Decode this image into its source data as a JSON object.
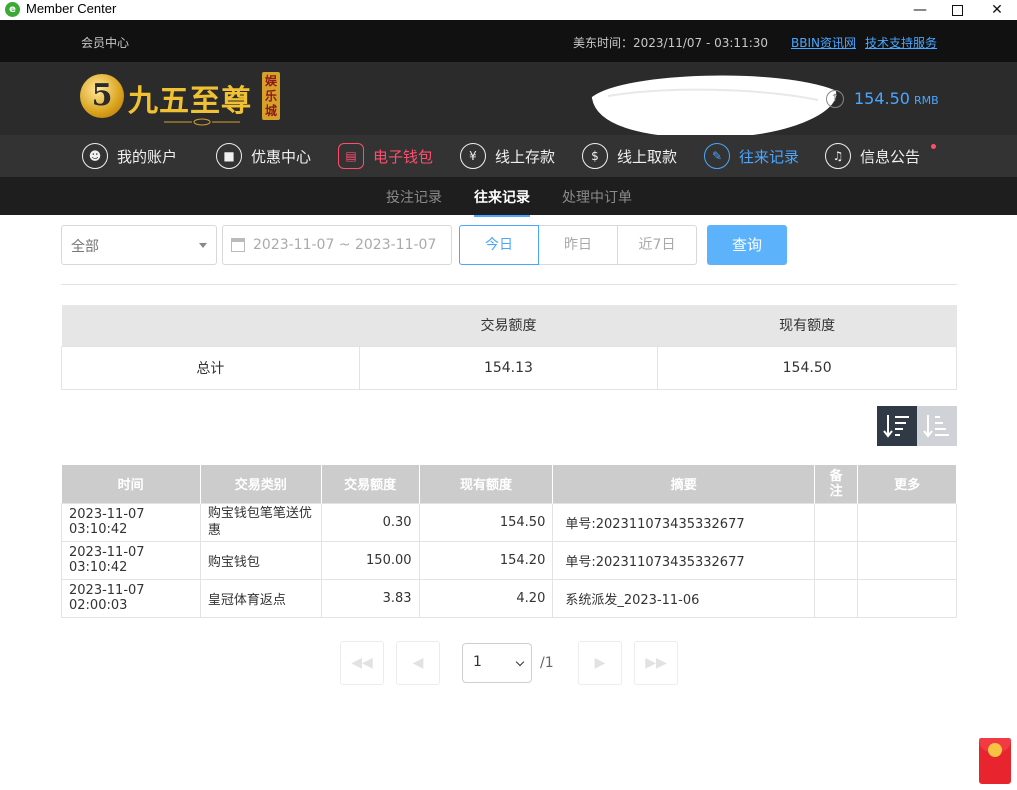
{
  "window": {
    "title": "Member Center",
    "app_icon_letter": "e"
  },
  "topbar": {
    "member_center": "会员中心",
    "time_text": "美东时间：2023/11/07 - 03:11:30",
    "link_news": "BBIN资讯网",
    "link_support": "技术支持服务"
  },
  "header": {
    "logo_numeral": "5",
    "logo_brand": "九五至尊",
    "logo_tag": "娱乐城",
    "balance_amount": "154.50",
    "balance_currency": "RMB"
  },
  "nav": {
    "items": [
      {
        "label": "我的账户",
        "icon": "user-icon"
      },
      {
        "label": "优惠中心",
        "icon": "gift-icon"
      },
      {
        "label": "电子钱包",
        "icon": "wallet-icon"
      },
      {
        "label": "线上存款",
        "icon": "deposit-icon"
      },
      {
        "label": "线上取款",
        "icon": "withdraw-icon"
      },
      {
        "label": "往来记录",
        "icon": "record-icon"
      },
      {
        "label": "信息公告",
        "icon": "bell-icon"
      }
    ],
    "active_index": 5,
    "wallet_color": "#ff4d6d",
    "active_color": "#4aa6ff"
  },
  "subnav": {
    "items": [
      "投注记录",
      "往来记录",
      "处理中订单"
    ],
    "active_index": 1
  },
  "filters": {
    "type_value": "全部",
    "date_range": "2023-11-07 ~ 2023-11-07",
    "today": "今日",
    "yesterday": "昨日",
    "last7": "近7日",
    "query": "查询"
  },
  "summary": {
    "headers": [
      "",
      "交易额度",
      "现有额度"
    ],
    "total_label": "总计",
    "trade_total": "154.13",
    "current_total": "154.50"
  },
  "records": {
    "headers": [
      "时间",
      "交易类别",
      "交易额度",
      "现有额度",
      "摘要",
      "备注",
      "更多"
    ],
    "rows": [
      {
        "time": "2023-11-07 03:10:42",
        "type": "购宝钱包笔笔送优惠",
        "amount": "0.30",
        "balance": "154.50",
        "summary": "单号:202311073435332677",
        "note": "",
        "more": ""
      },
      {
        "time": "2023-11-07 03:10:42",
        "type": "购宝钱包",
        "amount": "150.00",
        "balance": "154.20",
        "summary": "单号:202311073435332677",
        "note": "",
        "more": ""
      },
      {
        "time": "2023-11-07 02:00:03",
        "type": "皇冠体育返点",
        "amount": "3.83",
        "balance": "4.20",
        "summary": "系统派发_2023-11-06",
        "note": "",
        "more": ""
      }
    ]
  },
  "pager": {
    "current": "1",
    "total": "/1"
  }
}
